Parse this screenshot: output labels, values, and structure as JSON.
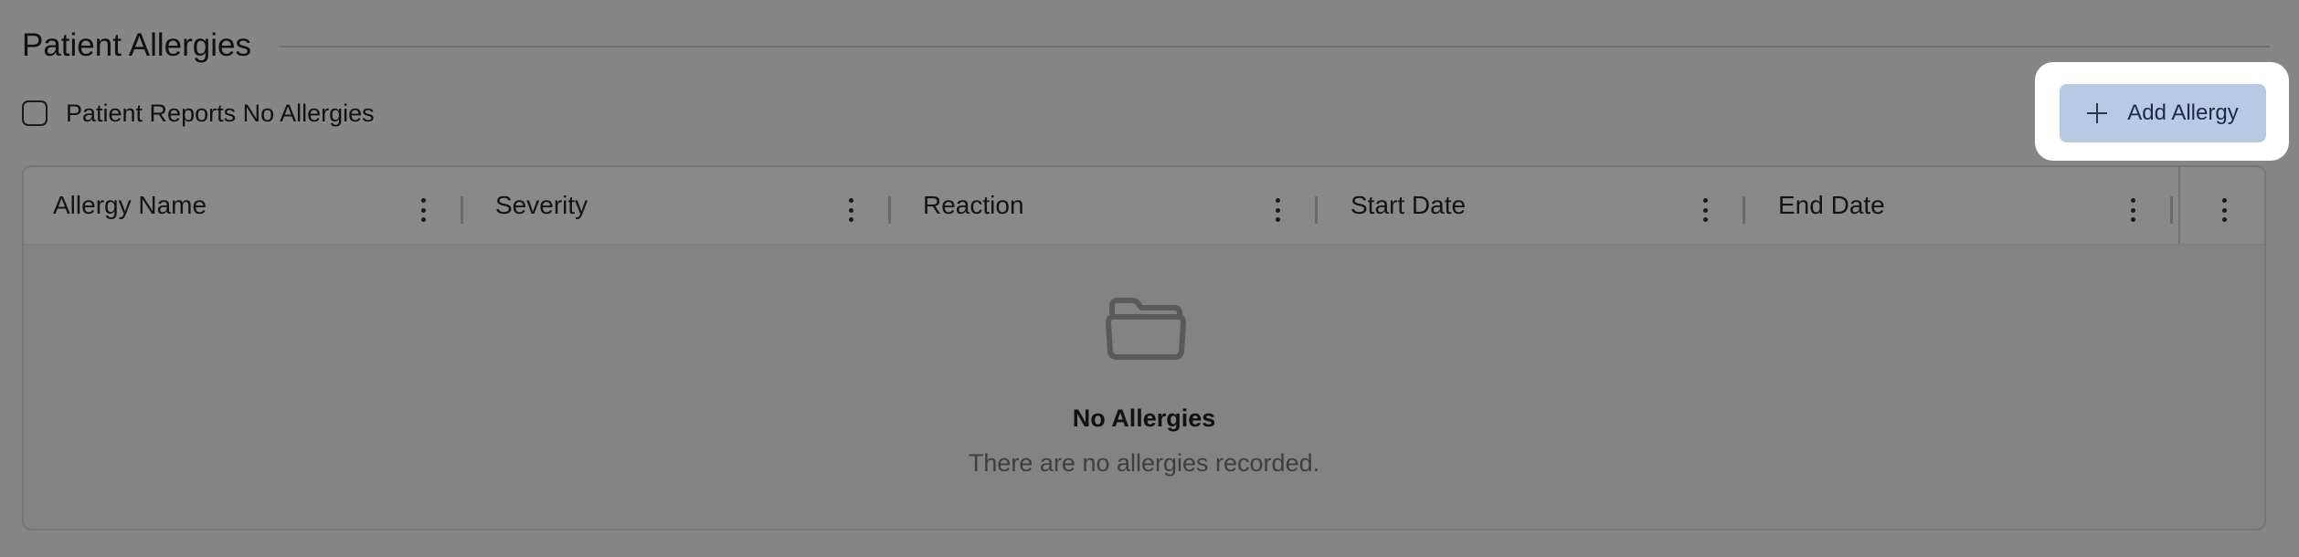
{
  "section": {
    "title": "Patient Allergies"
  },
  "no_allergies_checkbox": {
    "label": "Patient Reports No Allergies",
    "checked": false
  },
  "add_button": {
    "label": "Add Allergy",
    "icon": "plus-icon",
    "background": "#b8c9e3"
  },
  "table": {
    "columns": [
      {
        "label": "Allergy Name"
      },
      {
        "label": "Severity"
      },
      {
        "label": "Reaction"
      },
      {
        "label": "Start Date"
      },
      {
        "label": "End Date"
      }
    ],
    "rows": [],
    "empty_state": {
      "icon": "folder-icon",
      "title": "No Allergies",
      "message": "There are no allergies recorded."
    }
  },
  "colors": {
    "overlay_background": "#868686",
    "highlight": "#ffffff",
    "text": "#111111"
  }
}
